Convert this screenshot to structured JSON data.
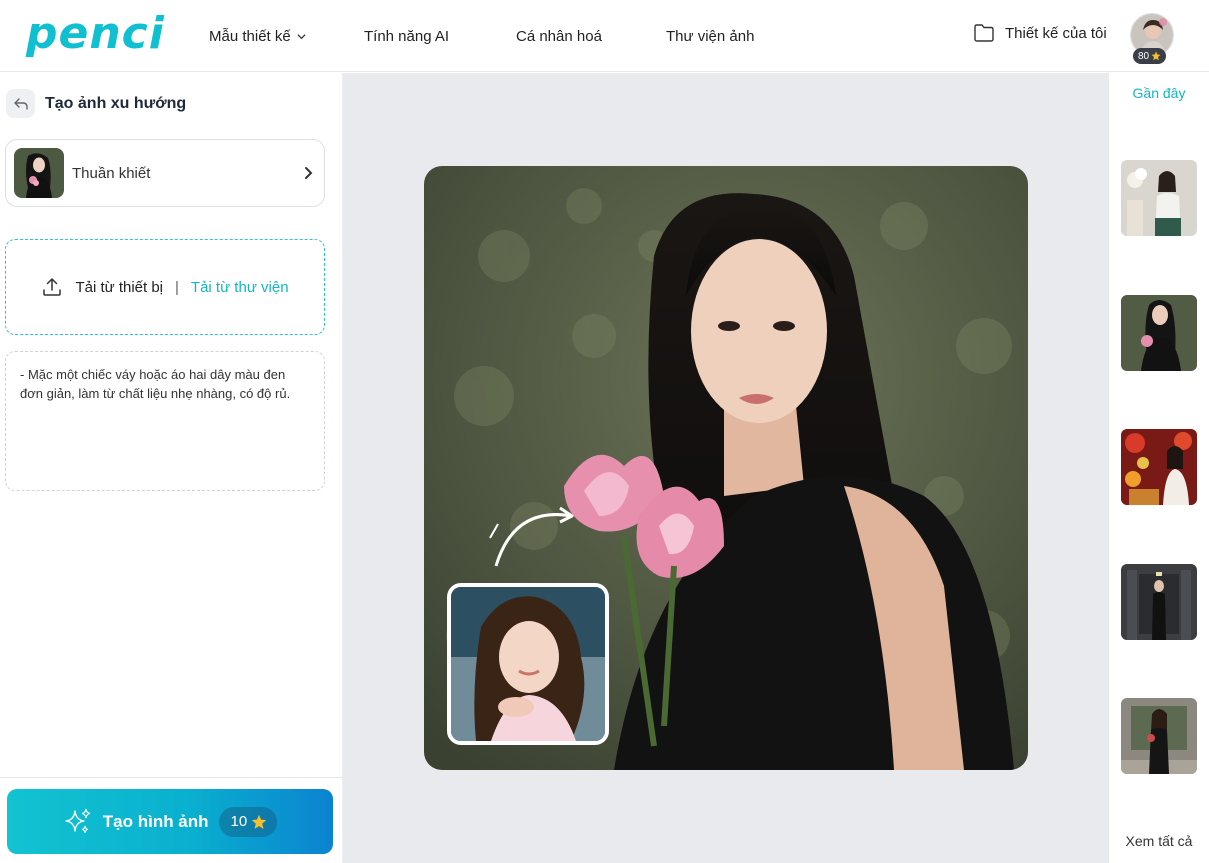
{
  "brand": {
    "logo": "penci",
    "accent": "#12bfcf"
  },
  "nav": [
    {
      "label": "Mẫu thiết kế",
      "has_dropdown": true
    },
    {
      "label": "Tính năng AI"
    },
    {
      "label": "Cá nhân hoá"
    },
    {
      "label": "Thư viện ảnh"
    }
  ],
  "header": {
    "my_designs": "Thiết kế của tôi",
    "coins": "80"
  },
  "left": {
    "title": "Tạo ảnh xu hướng",
    "style_name": "Thuần khiết",
    "upload_device": "Tải từ thiết bị",
    "upload_separator": "|",
    "upload_library": "Tải từ thư viện",
    "prompt_text": "- Mặc một chiếc váy hoặc áo hai dây màu đen đơn giản, làm từ chất liệu nhẹ nhàng, có độ rủ.",
    "generate_label": "Tạo hình ảnh",
    "generate_cost": "10"
  },
  "right": {
    "title": "Gần đây",
    "see_all": "Xem tất cả"
  },
  "icons": {
    "back": "reply-arrow-icon",
    "folder": "folder-icon",
    "upload": "upload-icon",
    "sparkle": "sparkle-icon",
    "star": "star-icon",
    "chevron": "chevron-right-icon"
  }
}
